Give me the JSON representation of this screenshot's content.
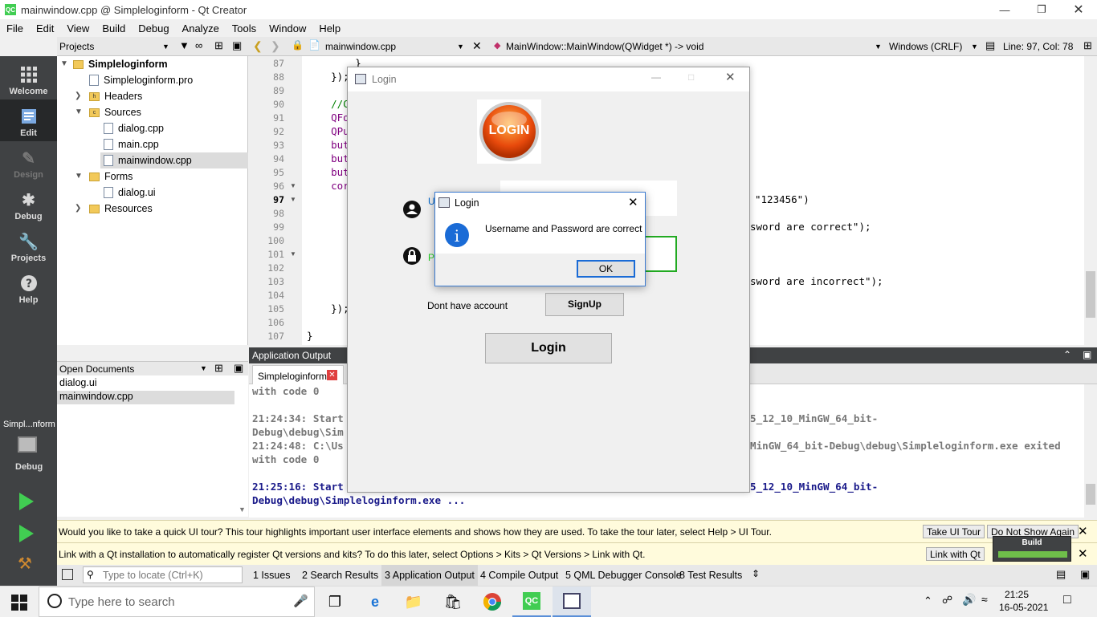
{
  "window": {
    "title": "mainwindow.cpp @ Simpleloginform - Qt Creator",
    "app_icon": "QC"
  },
  "menu": [
    "File",
    "Edit",
    "View",
    "Build",
    "Debug",
    "Analyze",
    "Tools",
    "Window",
    "Help"
  ],
  "toolbar": {
    "projects_label": "Projects",
    "file_name": "mainwindow.cpp",
    "function": "MainWindow::MainWindow(QWidget *) -> void",
    "line_ending": "Windows (CRLF)",
    "position": "Line: 97, Col: 78"
  },
  "modes": [
    {
      "label": "Welcome",
      "icon": "grid-icon"
    },
    {
      "label": "Edit",
      "icon": "edit-icon"
    },
    {
      "label": "Design",
      "icon": "pen-icon"
    },
    {
      "label": "Debug",
      "icon": "bug-icon"
    },
    {
      "label": "Projects",
      "icon": "wrench-icon"
    },
    {
      "label": "Help",
      "icon": "help-icon"
    }
  ],
  "kit": {
    "project": "Simpl...nform",
    "mode": "Debug"
  },
  "tree": {
    "project": "Simpleloginform",
    "pro_file": "Simpleloginform.pro",
    "headers": "Headers",
    "sources": "Sources",
    "source_files": [
      "dialog.cpp",
      "main.cpp",
      "mainwindow.cpp"
    ],
    "forms": "Forms",
    "form_files": [
      "dialog.ui"
    ],
    "resources": "Resources"
  },
  "open_documents": {
    "label": "Open Documents",
    "files": [
      "dialog.ui",
      "mainwindow.cpp"
    ]
  },
  "editor": {
    "line_numbers": [
      "87",
      "88",
      "89",
      "90",
      "91",
      "92",
      "93",
      "94",
      "95",
      "96",
      "97",
      "98",
      "99",
      "100",
      "101",
      "102",
      "103",
      "104",
      "105",
      "106",
      "107"
    ],
    "code": [
      "        }",
      "    });",
      "",
      "    //C",
      "    QFo",
      "    QPu",
      "    but",
      "    but",
      "    but",
      "    cor",
      "",
      "",
      "",
      "",
      "",
      "",
      "",
      "",
      "    });",
      "",
      "}"
    ],
    "code_right": {
      "l97": "\"123456\")",
      "l99": "sword are correct\");",
      "l103": "sword are incorrect\");"
    }
  },
  "output": {
    "label": "Application Output",
    "tab": "Simpleloginform",
    "lines": [
      {
        "text": "with code 0",
        "bold_blue": false
      },
      {
        "text": "",
        "bold_blue": false
      },
      {
        "text": "21:24:34: Start",
        "right": "5_12_10_MinGW_64_bit-",
        "bold_blue": false
      },
      {
        "text": "Debug\\debug\\Sim",
        "right": "",
        "bold_blue": false
      },
      {
        "text": "21:24:48: C:\\Us",
        "right": "MinGW_64_bit-Debug\\debug\\Simpleloginform.exe exited",
        "bold_blue": false
      },
      {
        "text": "with code 0",
        "bold_blue": false
      },
      {
        "text": "",
        "bold_blue": false
      },
      {
        "text": "21:25:16: Start",
        "right": "5_12_10_MinGW_64_bit-",
        "bold_blue": true
      },
      {
        "text": "Debug\\debug\\Simpleloginform.exe ...",
        "bold_blue": true
      }
    ]
  },
  "infobars": [
    {
      "text": "Would you like to take a quick UI tour? This tour highlights important user interface elements and shows how they are used. To take the tour later, select Help > UI Tour.",
      "btn1": "Take UI Tour",
      "btn2": "Do Not Show Again"
    },
    {
      "text": "Link with a Qt installation to automatically register Qt versions and kits? To do this later, select Options > Kits > Qt Versions > Link with Qt.",
      "btn1": "Link with Qt"
    }
  ],
  "build_popup": {
    "label": "Build",
    "progress": 1.0,
    "color": "#6fbf4a"
  },
  "statusbar": {
    "locate_placeholder": "Type to locate (Ctrl+K)",
    "panes": [
      "1  Issues",
      "2  Search Results",
      "3  Application Output",
      "4  Compile Output",
      "5  QML Debugger Console",
      "8  Test Results"
    ]
  },
  "login_window": {
    "title": "Login",
    "logo_text": "LOGIN",
    "username_label": "U",
    "password_label": "Pa",
    "no_account": "Dont have account",
    "signup": "SignUp",
    "login": "Login"
  },
  "message_box": {
    "title": "Login",
    "message": "Username and Password are correct",
    "ok": "OK"
  },
  "taskbar": {
    "search_placeholder": "Type here to search",
    "time": "21:25",
    "date": "16-05-2021"
  },
  "colors": {
    "accent_green": "#41cd52",
    "mode_bar": "#404244",
    "message_border": "#3a7ad0"
  }
}
